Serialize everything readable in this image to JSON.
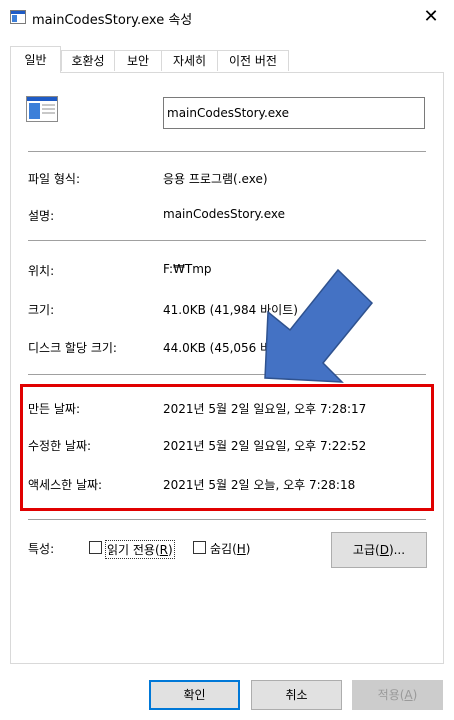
{
  "window": {
    "title": "mainCodesStory.exe 속성",
    "close_glyph": "✕"
  },
  "tabs": [
    {
      "label": "일반"
    },
    {
      "label": "호환성"
    },
    {
      "label": "보안"
    },
    {
      "label": "자세히"
    },
    {
      "label": "이전 버전"
    }
  ],
  "file": {
    "name": "mainCodesStory.exe"
  },
  "props": {
    "type_label": "파일 형식:",
    "type_value": "응용 프로그램(.exe)",
    "desc_label": "설명:",
    "desc_value": "mainCodesStory.exe",
    "location_label": "위치:",
    "location_value": "F:₩Tmp",
    "size_label": "크기:",
    "size_value": "41.0KB (41,984 바이트)",
    "disk_label": "디스크 할당 크기:",
    "disk_value": "44.0KB (45,056 바이트)",
    "created_label": "만든 날짜:",
    "created_value": "2021년 5월 2일 일요일, 오후 7:28:17",
    "modified_label": "수정한 날짜:",
    "modified_value": "2021년 5월 2일 일요일, 오후 7:22:52",
    "accessed_label": "액세스한 날짜:",
    "accessed_value": "2021년 5월 2일 오늘, 오후 7:28:18"
  },
  "attributes": {
    "label": "특성:",
    "readonly_text": "읽기 전용(",
    "readonly_key": "R",
    "hidden_text": "숨김(",
    "hidden_key": "H",
    "paren_close": ")",
    "advanced_text": "고급(",
    "advanced_key": "D",
    "advanced_suffix": ")..."
  },
  "buttons": {
    "ok": "확인",
    "cancel": "취소",
    "apply_text": "적용(",
    "apply_key": "A",
    "apply_suffix": ")"
  },
  "colors": {
    "highlight_border": "#e00000",
    "arrow_fill": "#4472c4",
    "default_button_border": "#0078d7"
  },
  "icons": {
    "title": "window-app-icon",
    "file": "exe-file-icon",
    "arrow": "pointer-arrow-annotation"
  }
}
